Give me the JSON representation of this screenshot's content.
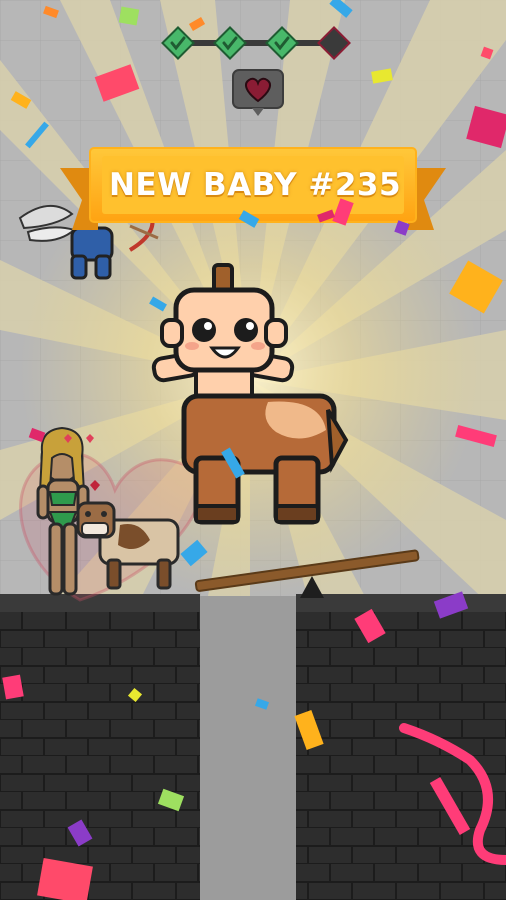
{
  "banner": {
    "title": "NEW BABY #235"
  },
  "progress": {
    "total_stages": 4,
    "completed_stages": 3
  },
  "heart_badge": {
    "icon": "heart-icon"
  },
  "colors": {
    "banner": "#ffb21c",
    "banner_dark": "#e08a10",
    "check": "#48b86a",
    "heart": "#8a1c34",
    "wall": "#2b2b2b",
    "sky": "#b7b7b7"
  }
}
